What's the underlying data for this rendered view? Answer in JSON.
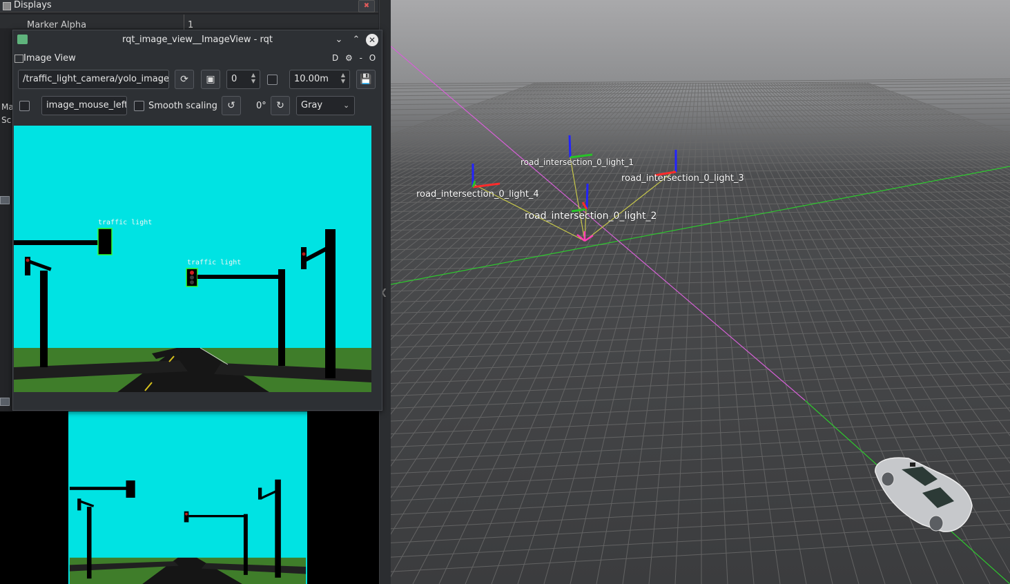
{
  "displays_panel": {
    "title": "Displays",
    "property_name": "Marker Alpha",
    "property_value": "1",
    "side_labels": [
      "Ma",
      "Sc"
    ]
  },
  "rqt_window": {
    "title": "rqt_image_view__ImageView - rqt",
    "plugin_title": "Image View",
    "plugin_buttons": "D ⚙ - O",
    "topic": "/traffic_light_camera/yolo_image",
    "spin_value": "0",
    "distance_value": "10.00m",
    "mouse_topic": "image_mouse_left",
    "smooth_scaling_label": "Smooth scaling",
    "rotation": "0°",
    "color_scheme": "Gray"
  },
  "camera_image": {
    "detections": [
      {
        "label": "traffic light"
      },
      {
        "label": "traffic light"
      }
    ]
  },
  "viewport": {
    "frames": [
      {
        "label": "road_intersection_0_light_1"
      },
      {
        "label": "road_intersection_0_light_3"
      },
      {
        "label": "road_intersection_0_light_4"
      },
      {
        "label": "road_intersection_0_light_2"
      }
    ]
  },
  "colors": {
    "sky": "#00e3e3",
    "grass": "#3f7d2a",
    "grid_line": "#5c5c5c",
    "x_axis": "#ff4b4b",
    "y_axis": "#27c427",
    "z_axis": "#2323ff",
    "link_line": "#c8c84a",
    "detection_box": "#31ff31"
  }
}
